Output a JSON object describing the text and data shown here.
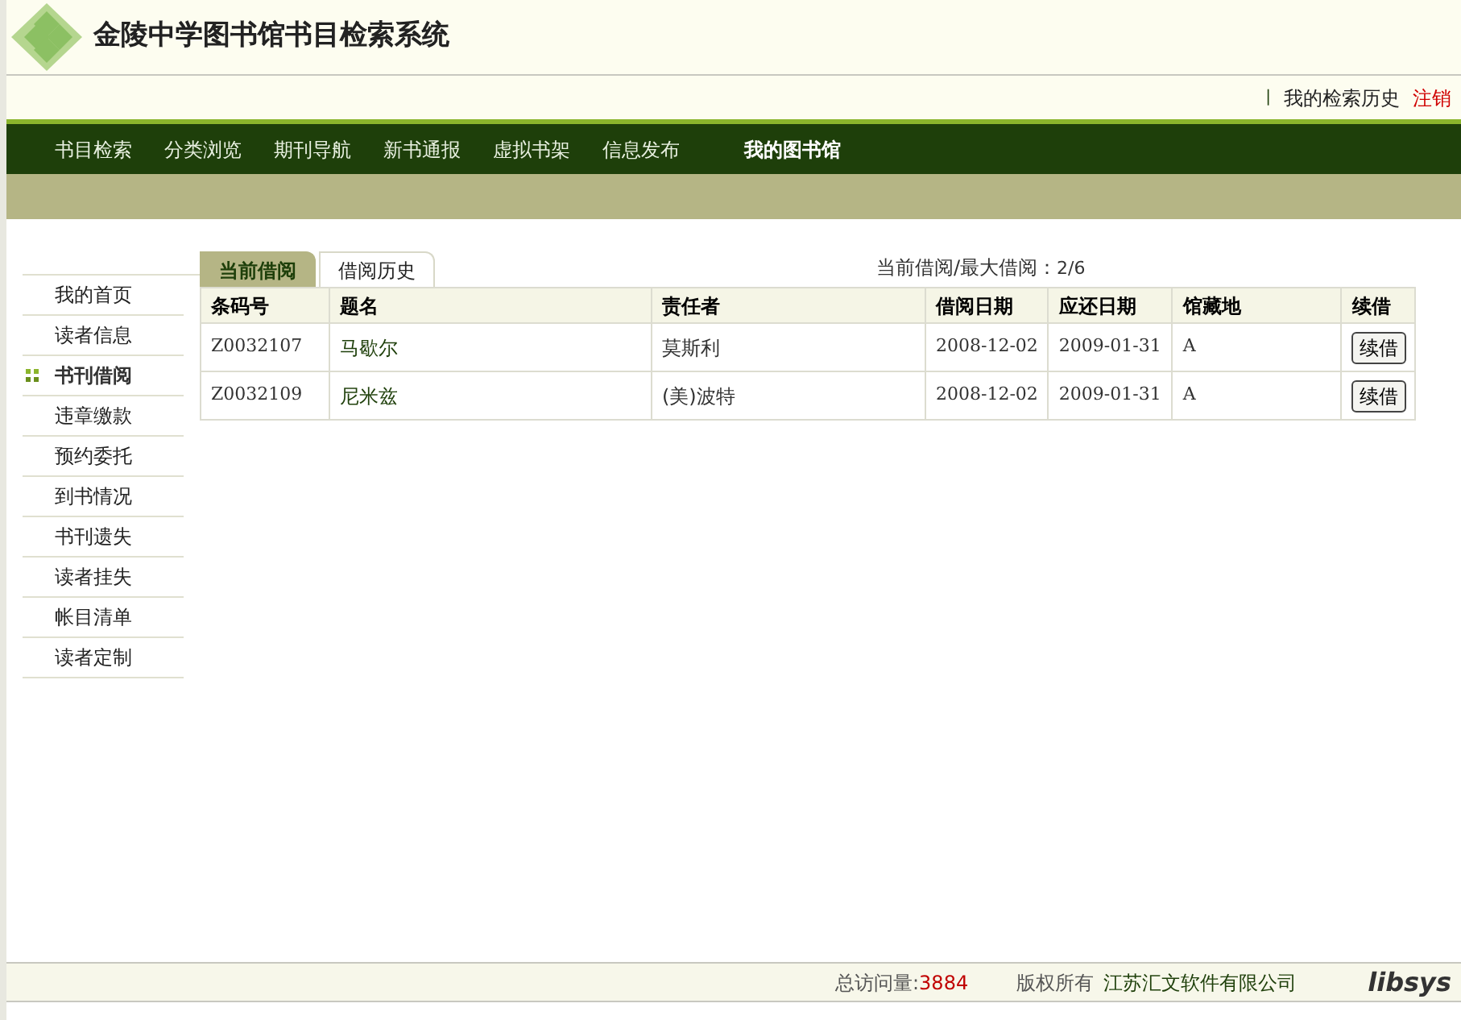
{
  "header": {
    "title": "金陵中学图书馆书目检索系统"
  },
  "top_separator": "|",
  "top_links": [
    {
      "label": "我的检索历史",
      "kind": "normal"
    },
    {
      "label": "注销",
      "kind": "alert"
    }
  ],
  "nav": [
    {
      "label": "书目检索",
      "selected": false
    },
    {
      "label": "分类浏览",
      "selected": false
    },
    {
      "label": "期刊导航",
      "selected": false
    },
    {
      "label": "新书通报",
      "selected": false
    },
    {
      "label": "虚拟书架",
      "selected": false
    },
    {
      "label": "信息发布",
      "selected": false
    },
    {
      "label": "我的图书馆",
      "selected": true
    }
  ],
  "sidebar": {
    "items": [
      {
        "label": "我的首页",
        "selected": false
      },
      {
        "label": "读者信息",
        "selected": false
      },
      {
        "label": "书刊借阅",
        "selected": true
      },
      {
        "label": "违章缴款",
        "selected": false
      },
      {
        "label": "预约委托",
        "selected": false
      },
      {
        "label": "到书情况",
        "selected": false
      },
      {
        "label": "书刊遗失",
        "selected": false
      },
      {
        "label": "读者挂失",
        "selected": false
      },
      {
        "label": "帐目清单",
        "selected": false
      },
      {
        "label": "读者定制",
        "selected": false
      }
    ]
  },
  "tabs": [
    {
      "label": "当前借阅",
      "selected": true
    },
    {
      "label": "借阅历史",
      "selected": false
    }
  ],
  "loan_count": {
    "label": "当前借阅/最大借阅：",
    "value": "2/6"
  },
  "table": {
    "columns": [
      "条码号",
      "题名",
      "责任者",
      "借阅日期",
      "应还日期",
      "馆藏地",
      "续借"
    ],
    "rows": [
      {
        "barcode": "Z0032107",
        "title": "马歇尔",
        "author": "莫斯利",
        "borrowed": "2008-12-02",
        "due": "2009-01-31",
        "location": "A",
        "action": "续借"
      },
      {
        "barcode": "Z0032109",
        "title": "尼米兹",
        "author": "(美)波特",
        "borrowed": "2008-12-02",
        "due": "2009-01-31",
        "location": "A",
        "action": "续借"
      }
    ]
  },
  "footer": {
    "visits_label": "总访问量:",
    "visits": "3884",
    "copyright_label": "版权所有",
    "company": "江苏汇文软件有限公司",
    "logo": "libsys"
  }
}
